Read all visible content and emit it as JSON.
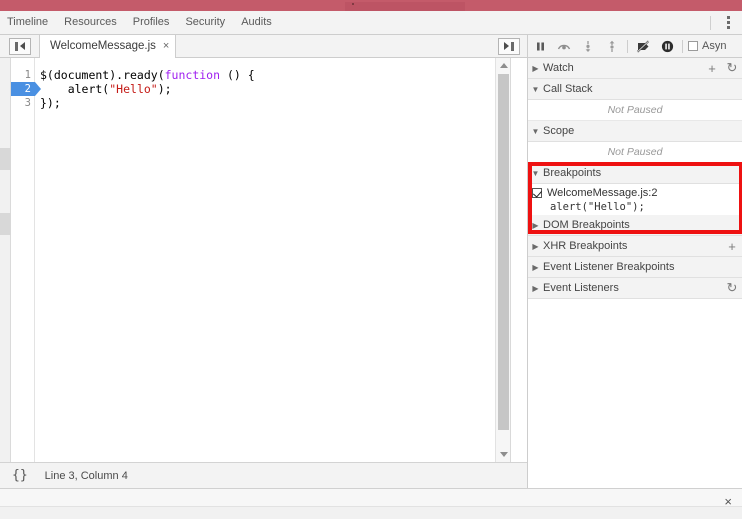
{
  "window": {
    "accent_red": "#c45b6a",
    "highlight_red": "#ee1111"
  },
  "panel_tabs": [
    {
      "label": "Timeline"
    },
    {
      "label": "Resources"
    },
    {
      "label": "Profiles"
    },
    {
      "label": "Security"
    },
    {
      "label": "Audits"
    }
  ],
  "menu": {
    "kebab_name": "more-options"
  },
  "sub_toolbar": {
    "navigator_toggle": "show-navigator",
    "file_tab": {
      "label": "WelcomeMessage.js",
      "close": "×"
    },
    "panel_open": "show-debugger"
  },
  "editor": {
    "lines": [
      {
        "number": "1",
        "breakpoint": false,
        "segments": [
          {
            "text": "$(document).ready(",
            "cls": ""
          },
          {
            "text": "function",
            "cls": "tok-kw"
          },
          {
            "text": " () {",
            "cls": ""
          }
        ]
      },
      {
        "number": "2",
        "breakpoint": true,
        "segments": [
          {
            "text": "    alert(",
            "cls": ""
          },
          {
            "text": "\"Hello\"",
            "cls": "tok-str"
          },
          {
            "text": ");",
            "cls": ""
          }
        ]
      },
      {
        "number": "3",
        "breakpoint": false,
        "segments": [
          {
            "text": "});",
            "cls": ""
          }
        ]
      }
    ]
  },
  "status_bar": {
    "format_icon": "{}",
    "position": "Line 3, Column 4"
  },
  "debug_toolbar": {
    "buttons": [
      {
        "name": "resume-script-execution-button",
        "glyph": "pause"
      },
      {
        "name": "step-over-next-function-call-button",
        "glyph": "step-over"
      },
      {
        "name": "step-into-next-function-call-button",
        "glyph": "step-into"
      },
      {
        "name": "step-out-of-current-function-button",
        "glyph": "step-out"
      },
      {
        "name": "deactivate-breakpoints-button",
        "glyph": "deactivate"
      },
      {
        "name": "pause-on-exceptions-button",
        "glyph": "pause-circle"
      }
    ],
    "async_label": "Asyn",
    "async_checked": false
  },
  "sidebar_sections": [
    {
      "name": "watch",
      "label": "Watch",
      "expanded": false,
      "arrow": "▶",
      "actions": [
        "+",
        "↻"
      ],
      "body": null
    },
    {
      "name": "call-stack",
      "label": "Call Stack",
      "expanded": true,
      "arrow": "▼",
      "actions": [],
      "body": "Not Paused"
    },
    {
      "name": "scope",
      "label": "Scope",
      "expanded": true,
      "arrow": "▼",
      "actions": [],
      "body": "Not Paused"
    }
  ],
  "breakpoints": {
    "header_label": "Breakpoints",
    "header_arrow": "▼",
    "items": [
      {
        "checked": true,
        "file": "WelcomeMessage.js:2",
        "code": "alert(\"Hello\");"
      }
    ]
  },
  "lower_sections": [
    {
      "name": "dom-breakpoints",
      "label": "DOM Breakpoints",
      "arrow": "▶",
      "action": ""
    },
    {
      "name": "xhr-breakpoints",
      "label": "XHR Breakpoints",
      "arrow": "▶",
      "action": "+"
    },
    {
      "name": "event-listener-breakpoints",
      "label": "Event Listener Breakpoints",
      "arrow": "▶",
      "action": ""
    },
    {
      "name": "event-listeners",
      "label": "Event Listeners",
      "arrow": "▶",
      "action": "↻"
    }
  ],
  "drawer": {
    "close_label": "×"
  }
}
